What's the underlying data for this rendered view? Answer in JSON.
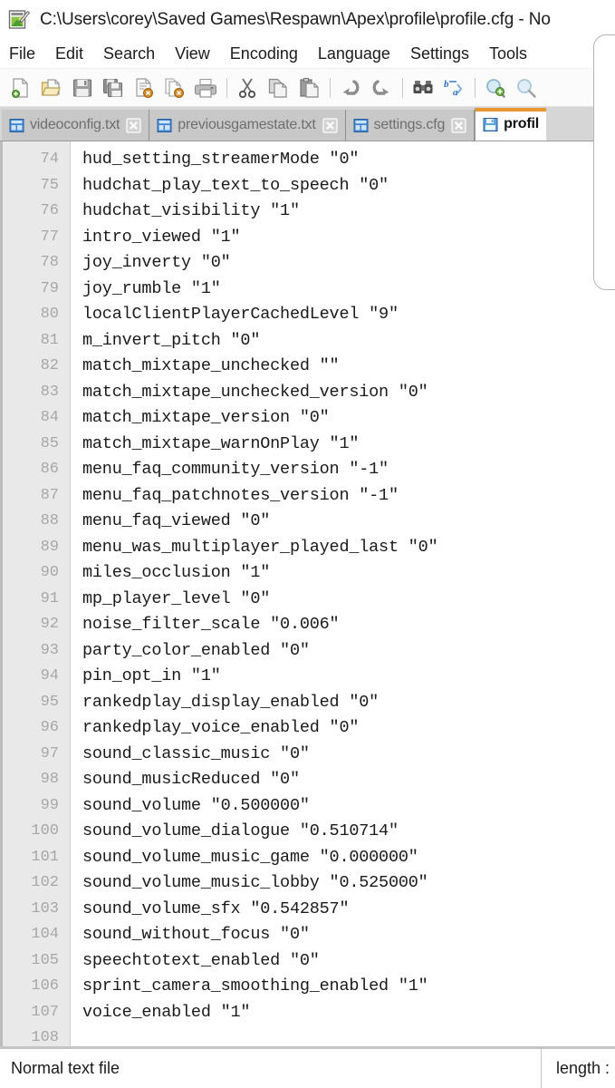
{
  "window": {
    "title": "C:\\Users\\corey\\Saved Games\\Respawn\\Apex\\profile\\profile.cfg - No",
    "app_icon": "notepad-plus-plus-icon"
  },
  "menubar": {
    "items": [
      {
        "label": "File"
      },
      {
        "label": "Edit"
      },
      {
        "label": "Search"
      },
      {
        "label": "View"
      },
      {
        "label": "Encoding"
      },
      {
        "label": "Language"
      },
      {
        "label": "Settings"
      },
      {
        "label": "Tools"
      }
    ]
  },
  "toolbar": {
    "buttons": [
      {
        "name": "new-file-icon"
      },
      {
        "name": "open-file-icon"
      },
      {
        "name": "save-icon"
      },
      {
        "name": "save-all-icon"
      },
      {
        "name": "close-file-icon"
      },
      {
        "name": "close-all-files-icon"
      },
      {
        "name": "print-icon"
      },
      {
        "name": "separator"
      },
      {
        "name": "cut-icon"
      },
      {
        "name": "copy-icon"
      },
      {
        "name": "paste-icon"
      },
      {
        "name": "separator"
      },
      {
        "name": "undo-icon"
      },
      {
        "name": "redo-icon"
      },
      {
        "name": "separator"
      },
      {
        "name": "find-icon"
      },
      {
        "name": "replace-icon"
      },
      {
        "name": "separator"
      },
      {
        "name": "zoom-in-icon"
      },
      {
        "name": "zoom-out-icon"
      }
    ]
  },
  "tabs": [
    {
      "label": "videoconfig.txt",
      "active": false
    },
    {
      "label": "previousgamestate.txt",
      "active": false
    },
    {
      "label": "settings.cfg",
      "active": false
    },
    {
      "label": "profil",
      "active": true
    }
  ],
  "editor": {
    "lines": [
      {
        "number": "74",
        "text": "hud_setting_streamerMode \"0\""
      },
      {
        "number": "75",
        "text": "hudchat_play_text_to_speech \"0\""
      },
      {
        "number": "76",
        "text": "hudchat_visibility \"1\""
      },
      {
        "number": "77",
        "text": "intro_viewed \"1\""
      },
      {
        "number": "78",
        "text": "joy_inverty \"0\""
      },
      {
        "number": "79",
        "text": "joy_rumble \"1\""
      },
      {
        "number": "80",
        "text": "localClientPlayerCachedLevel \"9\""
      },
      {
        "number": "81",
        "text": "m_invert_pitch \"0\""
      },
      {
        "number": "82",
        "text": "match_mixtape_unchecked \"\""
      },
      {
        "number": "83",
        "text": "match_mixtape_unchecked_version \"0\""
      },
      {
        "number": "84",
        "text": "match_mixtape_version \"0\""
      },
      {
        "number": "85",
        "text": "match_mixtape_warnOnPlay \"1\""
      },
      {
        "number": "86",
        "text": "menu_faq_community_version \"-1\""
      },
      {
        "number": "87",
        "text": "menu_faq_patchnotes_version \"-1\""
      },
      {
        "number": "88",
        "text": "menu_faq_viewed \"0\""
      },
      {
        "number": "89",
        "text": "menu_was_multiplayer_played_last \"0\""
      },
      {
        "number": "90",
        "text": "miles_occlusion \"1\""
      },
      {
        "number": "91",
        "text": "mp_player_level \"0\""
      },
      {
        "number": "92",
        "text": "noise_filter_scale \"0.006\""
      },
      {
        "number": "93",
        "text": "party_color_enabled \"0\""
      },
      {
        "number": "94",
        "text": "pin_opt_in \"1\""
      },
      {
        "number": "95",
        "text": "rankedplay_display_enabled \"0\""
      },
      {
        "number": "96",
        "text": "rankedplay_voice_enabled \"0\""
      },
      {
        "number": "97",
        "text": "sound_classic_music \"0\""
      },
      {
        "number": "98",
        "text": "sound_musicReduced \"0\""
      },
      {
        "number": "99",
        "text": "sound_volume \"0.500000\""
      },
      {
        "number": "100",
        "text": "sound_volume_dialogue \"0.510714\""
      },
      {
        "number": "101",
        "text": "sound_volume_music_game \"0.000000\""
      },
      {
        "number": "102",
        "text": "sound_volume_music_lobby \"0.525000\""
      },
      {
        "number": "103",
        "text": "sound_volume_sfx \"0.542857\""
      },
      {
        "number": "104",
        "text": "sound_without_focus \"0\""
      },
      {
        "number": "105",
        "text": "speechtotext_enabled \"0\""
      },
      {
        "number": "106",
        "text": "sprint_camera_smoothing_enabled \"1\""
      },
      {
        "number": "107",
        "text": "voice_enabled \"1\""
      },
      {
        "number": "108",
        "text": ""
      }
    ]
  },
  "statusbar": {
    "file_type": "Normal text file",
    "length_label": "length :"
  },
  "colors": {
    "active_tab_accent": "#e8972e",
    "tabbar_bg": "#d6d6d6",
    "inactive_tab_bg": "#c8c8c8",
    "gutter_bg": "#e9e9e9",
    "line_number": "#a7a7a7",
    "code_text": "#1a1a1a"
  }
}
